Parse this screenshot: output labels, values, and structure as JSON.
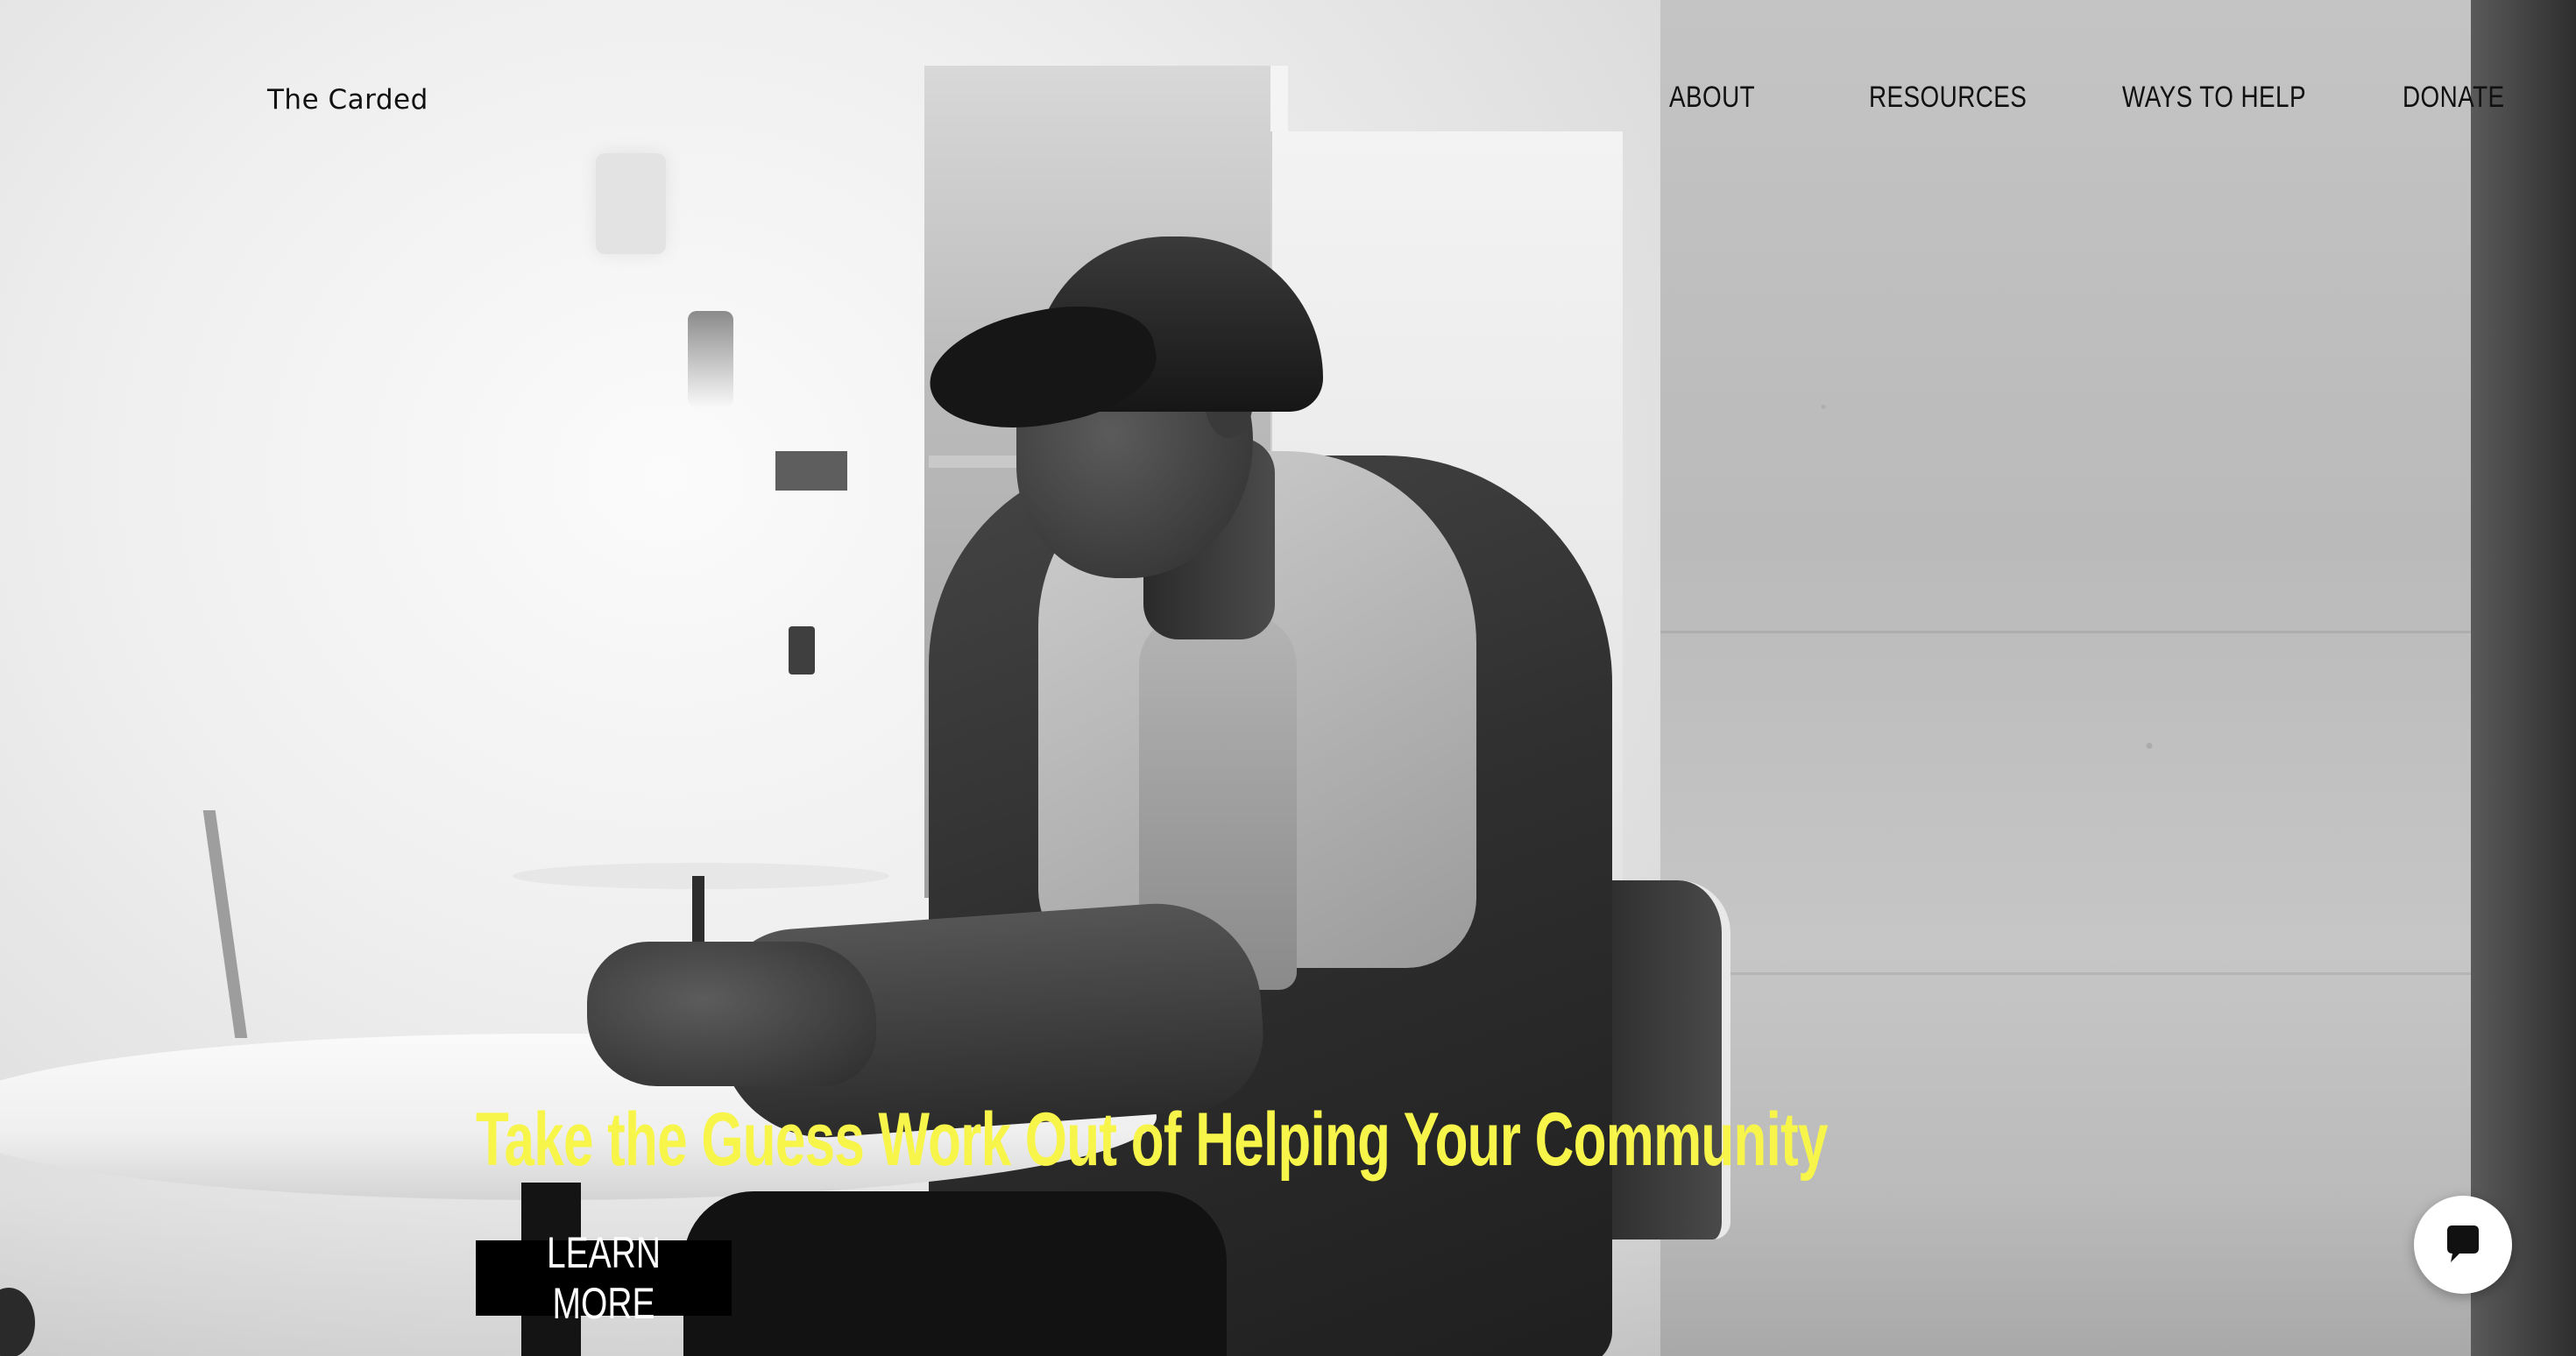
{
  "site": {
    "logo_text": "The Carded"
  },
  "nav": {
    "items": [
      {
        "label": "ABOUT"
      },
      {
        "label": "RESOURCES"
      },
      {
        "label": "WAYS TO HELP"
      },
      {
        "label": "DONATE"
      }
    ]
  },
  "hero": {
    "heading": "Take the Guess Work Out of Helping Your Community",
    "cta_label": "LEARN MORE",
    "image_style": "black-and-white photo of a young man in a cap and hooded jacket seated at a table",
    "heading_color": "#f7f54a",
    "cta_background": "#000000",
    "cta_text_color": "#ffffff"
  },
  "chat": {
    "icon": "chat-bubble-icon",
    "background": "#ffffff"
  }
}
